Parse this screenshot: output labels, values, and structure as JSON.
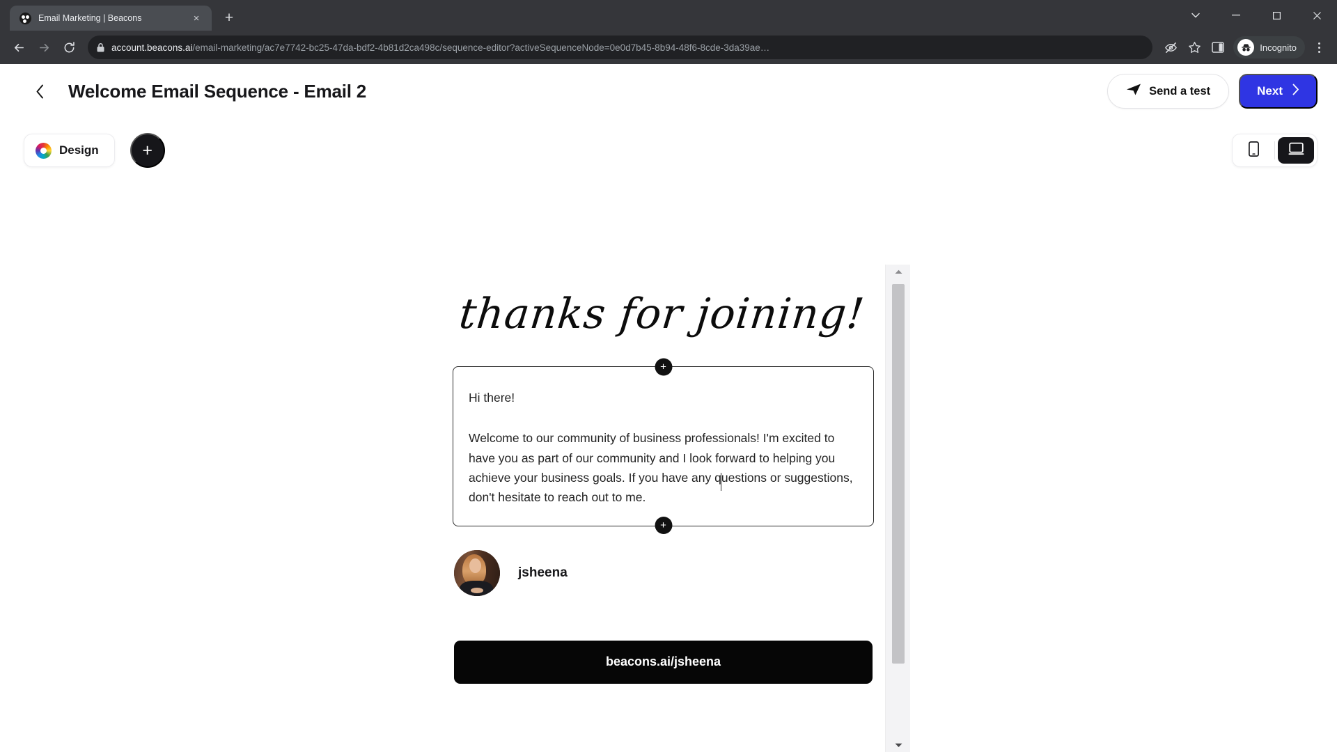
{
  "browser": {
    "tab": {
      "title": "Email Marketing | Beacons",
      "favicon": "beacons-logo-icon",
      "close": "×"
    },
    "new_tab_label": "+",
    "window_controls": {
      "minimize": "–",
      "maximize": "☐",
      "close": "✕",
      "tab_search": "⌄"
    },
    "url": {
      "host": "account.beacons.ai",
      "path": "/email-marketing/ac7e7742-bc25-47da-bdf2-4b81d2ca498c/sequence-editor?activeSequenceNode=0e0d7b45-8b94-48f6-8cde-3da39ae…"
    },
    "profile_label": "Incognito"
  },
  "header": {
    "back_label": "‹",
    "title": "Welcome Email Sequence - Email 2",
    "send_test_label": "Send a test",
    "next_label": "Next",
    "next_chevron": "›",
    "next_color": "#2f35e3"
  },
  "toolbar": {
    "design_label": "Design",
    "add_block_label": "+",
    "device_mobile": "mobile-icon",
    "device_desktop": "desktop-icon",
    "active_device": "desktop"
  },
  "email": {
    "heading": "thanks for joining!",
    "body": {
      "greeting": "Hi there!",
      "paragraph": "Welcome to our community of business professionals! I'm excited to have you as part of our community and I look forward to helping you achieve your business goals. If you have any questions or suggestions, don't hesitate to reach out to me."
    },
    "add_node_label": "+",
    "profile": {
      "username": "jsheena",
      "avatar": "user-avatar-photo"
    },
    "cta_label": "beacons.ai/jsheena",
    "cta_color": "#060606"
  },
  "scrollbar": {
    "up_arrow": "▲",
    "down_arrow": "▼"
  }
}
